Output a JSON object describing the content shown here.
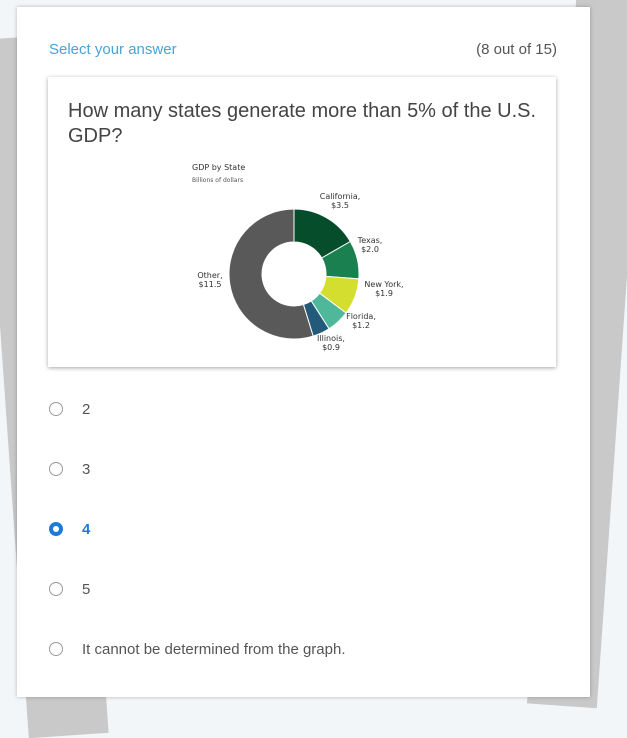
{
  "header": {
    "title": "Select your answer",
    "progress": "(8 out of 15)"
  },
  "question": {
    "text": "How many states generate more than 5% of the U.S. GDP?"
  },
  "chart_data": {
    "type": "pie",
    "title": "GDP by State",
    "subtitle": "Billions of dollars",
    "slices": [
      {
        "label": "California,",
        "value_label": "$3.5",
        "value": 3.5,
        "color": "#064d2c"
      },
      {
        "label": "Texas,",
        "value_label": "$2.0",
        "value": 2.0,
        "color": "#1a8050"
      },
      {
        "label": "New York,",
        "value_label": "$1.9",
        "value": 1.9,
        "color": "#d4de2e"
      },
      {
        "label": "Florida,",
        "value_label": "$1.2",
        "value": 1.2,
        "color": "#4fb89b"
      },
      {
        "label": "Illinois,",
        "value_label": "$0.9",
        "value": 0.9,
        "color": "#235a7a"
      },
      {
        "label": "Other,",
        "value_label": "$11.5",
        "value": 11.5,
        "color": "#595959"
      }
    ]
  },
  "options": [
    {
      "label": "2",
      "selected": false
    },
    {
      "label": "3",
      "selected": false
    },
    {
      "label": "4",
      "selected": true
    },
    {
      "label": "5",
      "selected": false
    },
    {
      "label": "It cannot be determined from the graph.",
      "selected": false
    }
  ]
}
